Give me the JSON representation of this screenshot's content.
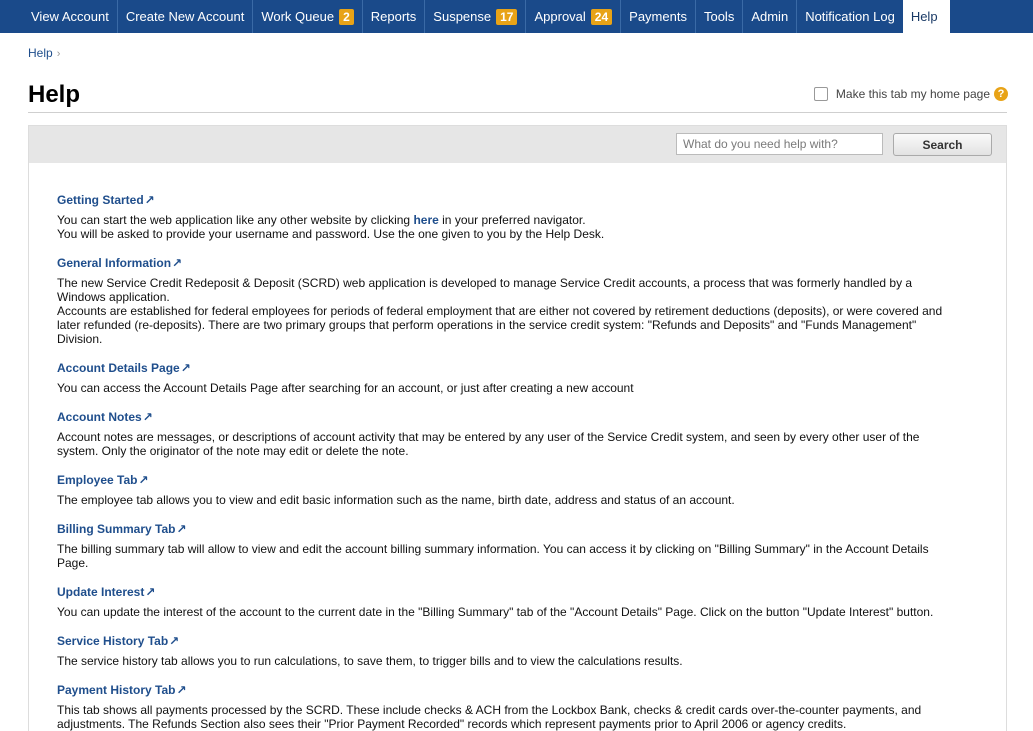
{
  "nav": {
    "tabs": [
      {
        "label": "View Account"
      },
      {
        "label": "Create New Account"
      },
      {
        "label": "Work Queue",
        "badge": "2"
      },
      {
        "label": "Reports"
      },
      {
        "label": "Suspense",
        "badge": "17"
      },
      {
        "label": "Approval",
        "badge": "24"
      },
      {
        "label": "Payments"
      },
      {
        "label": "Tools"
      },
      {
        "label": "Admin"
      },
      {
        "label": "Notification Log"
      },
      {
        "label": "Help",
        "active": true
      }
    ],
    "colors": {
      "bar": "#1a4a8a",
      "badge": "#e8a317"
    }
  },
  "breadcrumb": {
    "label": "Help"
  },
  "page": {
    "title": "Help",
    "home_page_label": "Make this tab my home page",
    "help_icon": "?"
  },
  "search": {
    "placeholder": "What do you need help with?",
    "button_label": "Search"
  },
  "sections": [
    {
      "title": "Getting Started",
      "lines": [
        "You can start the web application like any other website by clicking",
        "here",
        "in your preferred navigator.",
        "You will be asked to provide your username and password. Use the one given to you by the Help Desk."
      ]
    },
    {
      "title": "General Information",
      "body": "The new Service Credit Redeposit & Deposit (SCRD) web application is developed to manage Service Credit accounts, a process that was formerly handled by a Windows application.",
      "body2": "Accounts are established for federal employees for periods of federal employment that are either not covered by retirement deductions (deposits), or were covered and later refunded (re-deposits). There are two primary groups that perform operations in the service credit system: \"Refunds and Deposits\" and \"Funds Management\" Division."
    },
    {
      "title": "Account Details Page",
      "body": "You can access the Account Details Page after searching for an account, or just after creating a new account"
    },
    {
      "title": "Account Notes",
      "body": "Account notes are messages, or descriptions of account activity that may be entered by any user of the Service Credit system, and seen by every other user of the system. Only the originator of the note may edit or delete the note."
    },
    {
      "title": "Employee Tab",
      "body": "The employee tab allows you to view and edit basic information such as the name, birth date, address and status of an account."
    },
    {
      "title": "Billing Summary Tab",
      "body": "The billing summary tab will allow to view and edit the account billing summary information. You can access it by clicking on \"Billing Summary\" in the Account Details Page."
    },
    {
      "title": "Update Interest",
      "body": "You can update the interest of the account to the current date in the \"Billing Summary\" tab of the \"Account Details\" Page. Click on the button \"Update Interest\" button."
    },
    {
      "title": "Service History Tab",
      "body": "The service history tab allows you to run calculations, to save them, to trigger bills and to view the calculations results."
    },
    {
      "title": "Payment History Tab",
      "body": "This tab shows all payments processed by the SCRD. These include checks & ACH from the Lockbox Bank, checks & credit cards over-the-counter payments, and adjustments. The Refunds Section also sees their \"Prior Payment Recorded\" records which represent payments prior to April 2006 or agency credits."
    }
  ]
}
